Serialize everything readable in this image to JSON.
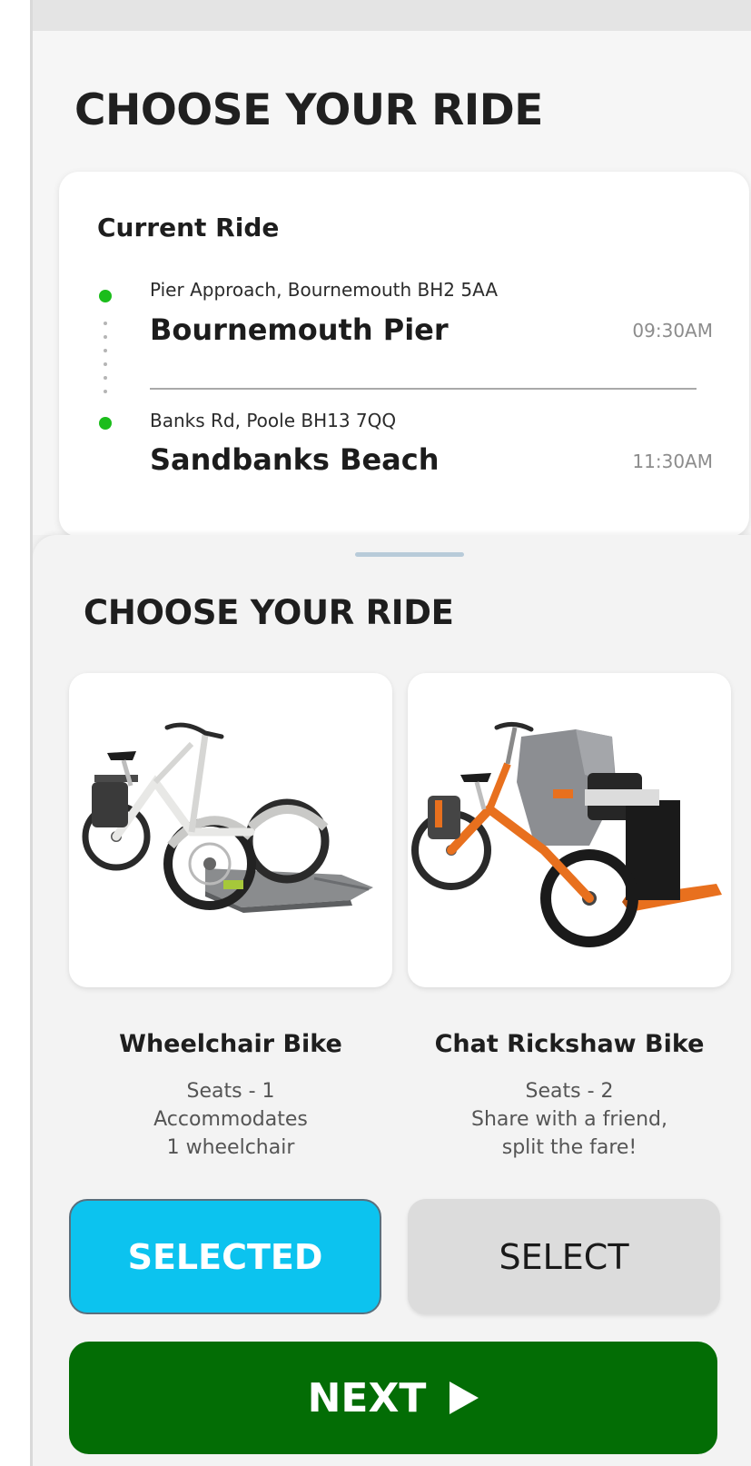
{
  "header": {
    "title": "CHOOSE YOUR RIDE"
  },
  "current_ride": {
    "title": "Current Ride",
    "pickup": {
      "address": "Pier Approach, Bournemouth BH2 5AA",
      "name": "Bournemouth Pier",
      "time": "09:30AM"
    },
    "dropoff": {
      "address": "Banks Rd, Poole BH13 7QQ",
      "name": "Sandbanks Beach",
      "time": "11:30AM"
    }
  },
  "sheet": {
    "title": "CHOOSE YOUR RIDE",
    "options": [
      {
        "name": "Wheelchair Bike",
        "description": "Seats - 1\nAccommodates\n1 wheelchair",
        "button_label": "SELECTED",
        "selected": true
      },
      {
        "name": "Chat Rickshaw Bike",
        "description": "Seats - 2\nShare with a friend,\nsplit the fare!",
        "button_label": "SELECT",
        "selected": false
      }
    ],
    "next_label": "NEXT"
  },
  "colors": {
    "route_dot": "#1bbd1b",
    "selected_button": "#0cc3ef",
    "unselected_button": "#dcdcdc",
    "next_button": "#036d05",
    "bike_frame_1": "#e8e8e6",
    "bike_frame_2": "#e8701e"
  },
  "icons": {
    "stop_marker": "green-dot-icon",
    "next": "play-triangle-icon"
  }
}
